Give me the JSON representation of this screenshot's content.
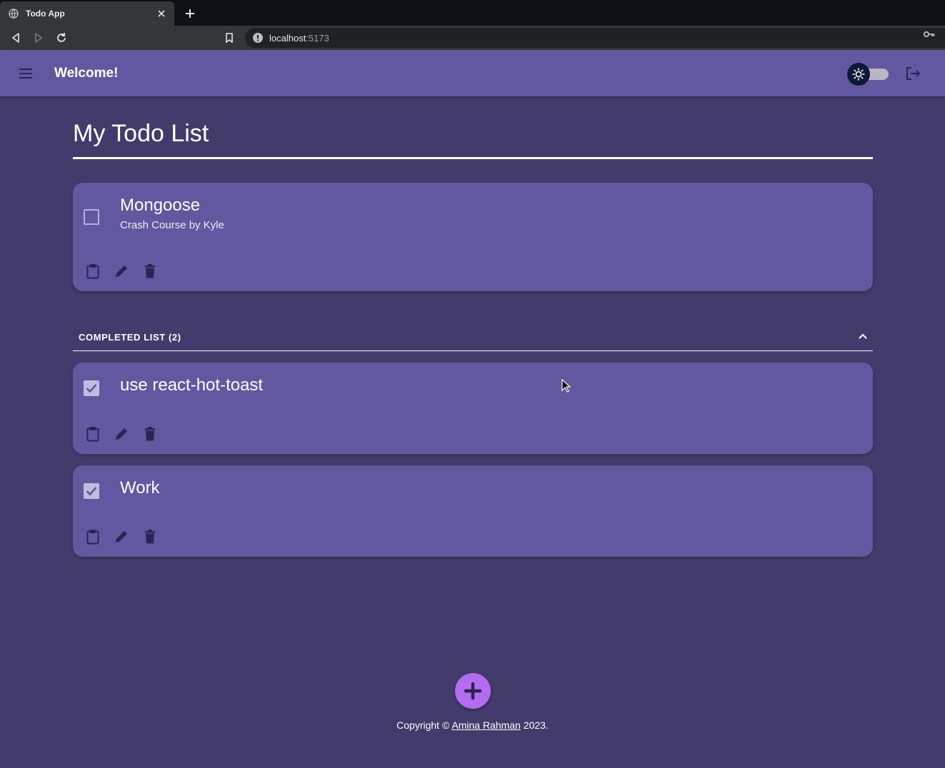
{
  "browser": {
    "tab_title": "Todo App",
    "url_host": "localhost",
    "url_port": ":5173"
  },
  "appbar": {
    "title": "Welcome!",
    "theme_mode": "light"
  },
  "main": {
    "page_title": "My Todo List",
    "active_todos": [
      {
        "title": "Mongoose",
        "description": "Crash Course by Kyle",
        "completed": false
      }
    ],
    "completed_section": {
      "label": "COMPLETED LIST (2)",
      "expanded": true,
      "todos": [
        {
          "title": "use react-hot-toast",
          "completed": true
        },
        {
          "title": "Work",
          "completed": true
        }
      ]
    }
  },
  "footer": {
    "prefix": "Copyright © ",
    "author": "Amina Rahman",
    "suffix": " 2023."
  },
  "colors": {
    "page_bg": "#433b6b",
    "card_bg": "#6258a0",
    "appbar_bg": "#6258a0",
    "fab_bg": "#b36cf0",
    "icon_dark": "#2a2450"
  },
  "icons": {
    "tab": "globe-icon",
    "menu": "hamburger-menu-icon",
    "theme": "sun-icon",
    "logout": "logout-icon",
    "todo_actions": [
      "clipboard-icon",
      "pencil-icon",
      "trash-icon"
    ],
    "collapse": "chevron-up-icon",
    "fab": "plus-icon"
  }
}
